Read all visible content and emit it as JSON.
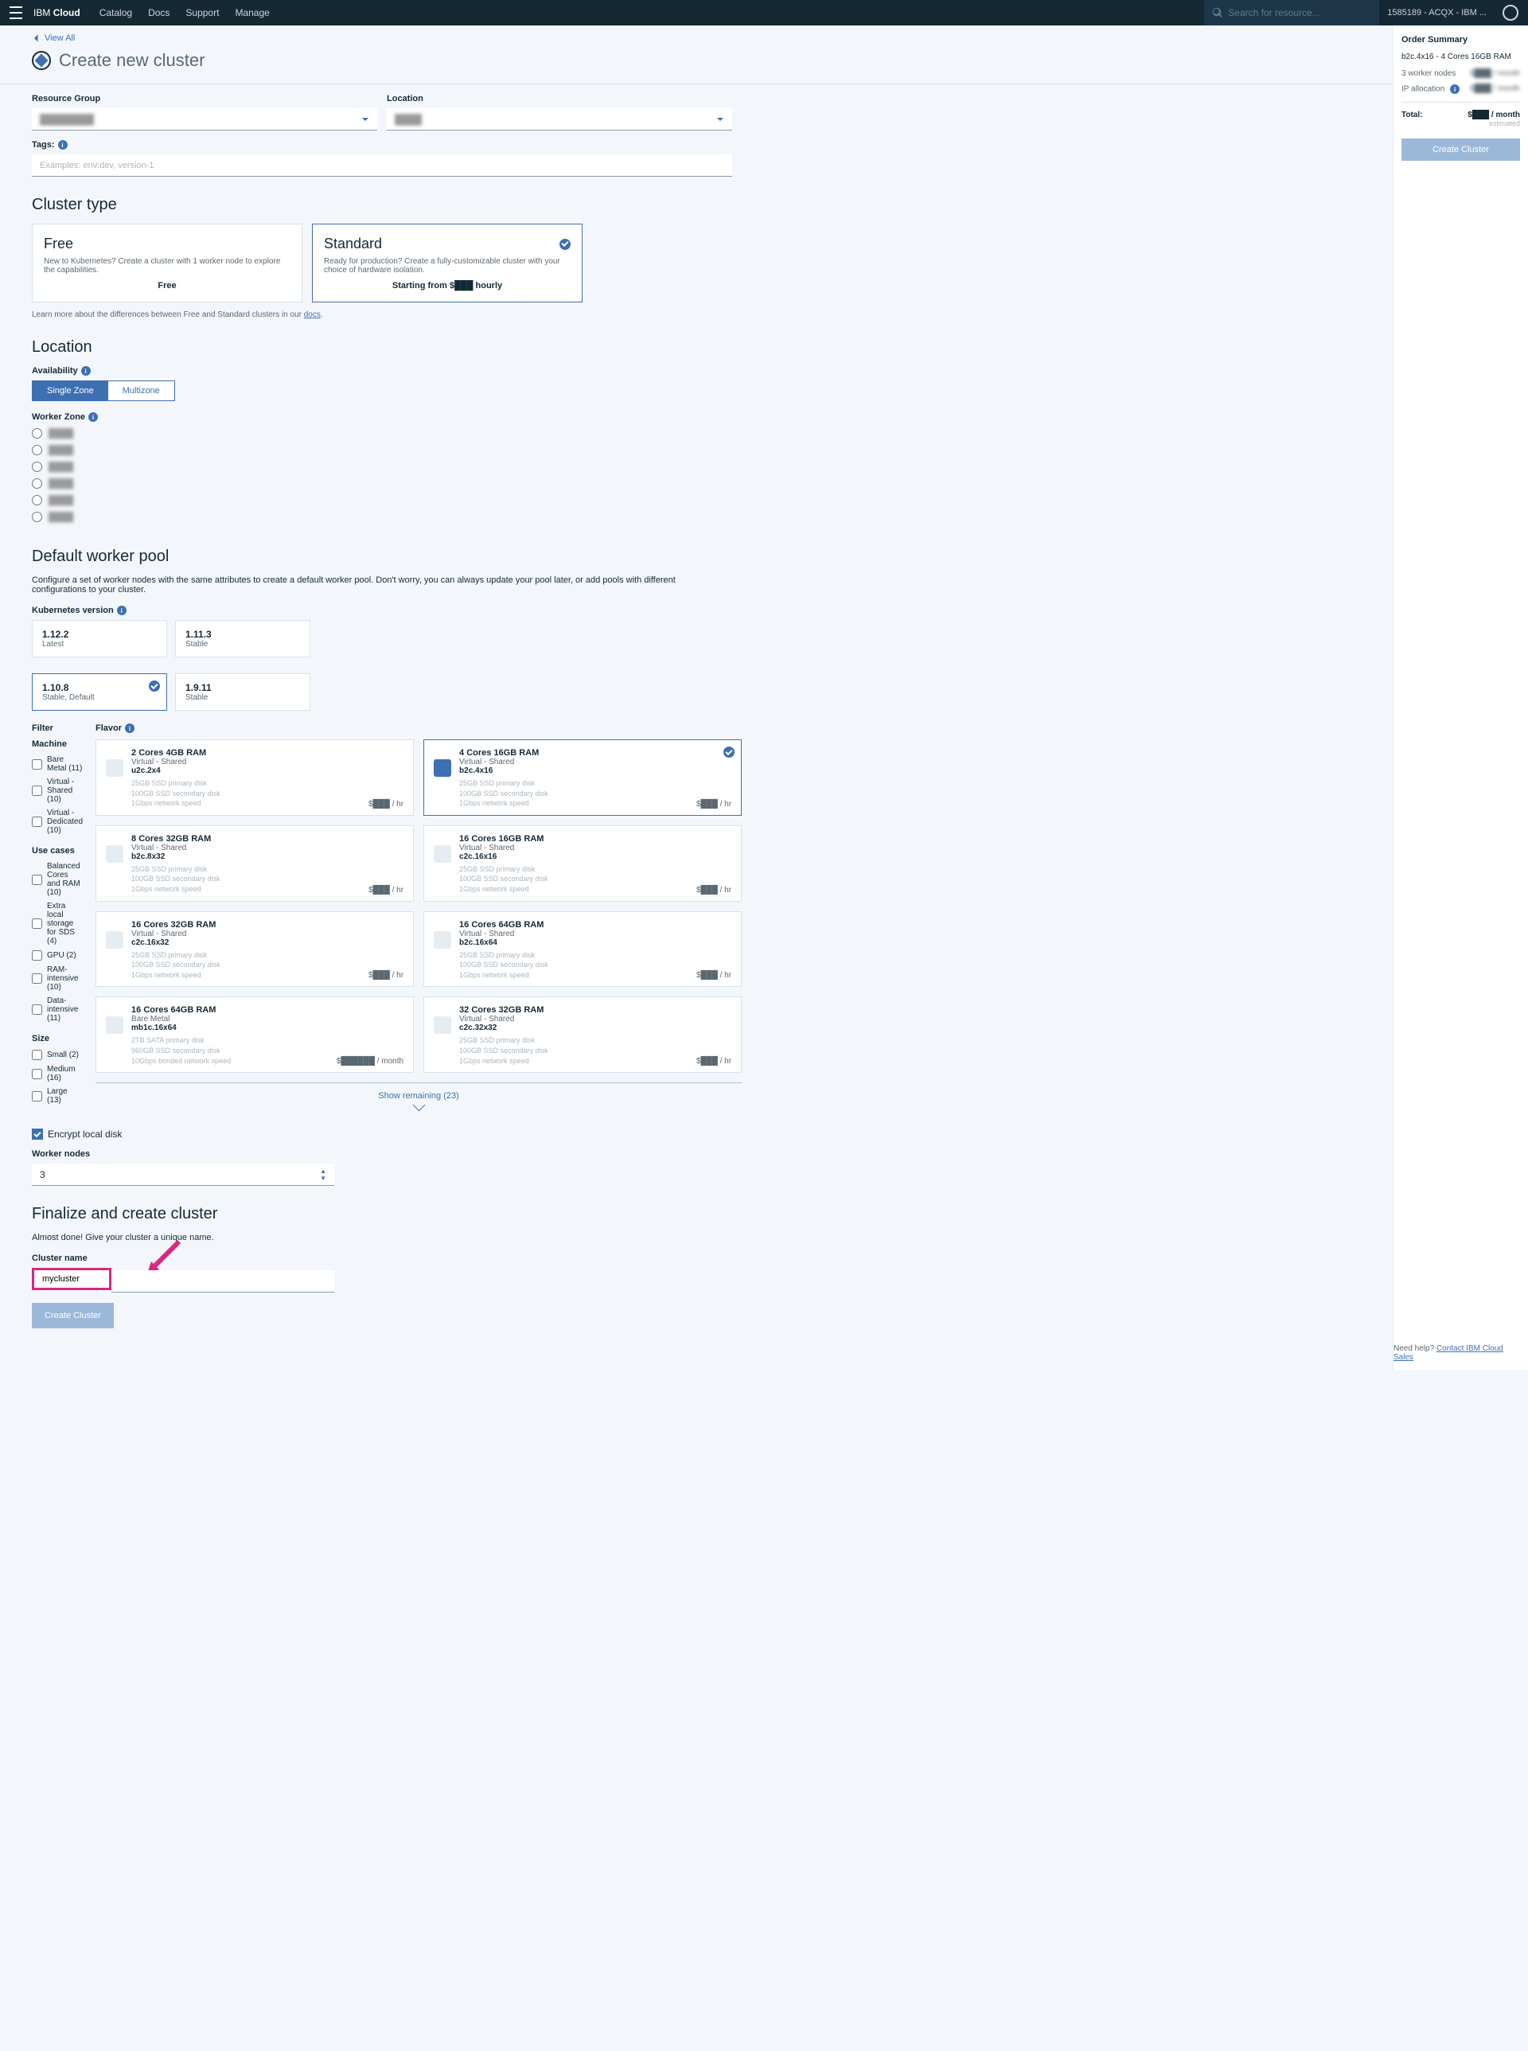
{
  "topbar": {
    "brand_prefix": "IBM",
    "brand_suffix": "Cloud",
    "nav": [
      "Catalog",
      "Docs",
      "Support",
      "Manage"
    ],
    "search_placeholder": "Search for resource...",
    "account": "1585189 - ACQX - IBM ..."
  },
  "header": {
    "back": "View All",
    "title": "Create new cluster"
  },
  "resource": {
    "group_label": "Resource Group",
    "group_value": "████████",
    "location_label": "Location",
    "location_value": "████",
    "tags_label": "Tags:",
    "tags_placeholder": "Examples: env:dev, version-1"
  },
  "cluster_type": {
    "heading": "Cluster type",
    "free": {
      "title": "Free",
      "desc": "New to Kubernetes? Create a cluster with 1 worker node to explore the capabilities.",
      "price": "Free"
    },
    "standard": {
      "title": "Standard",
      "desc": "Ready for production? Create a fully-customizable cluster with your choice of hardware isolation.",
      "price": "Starting from $███ hourly"
    },
    "note_prefix": "Learn more about the differences between Free and Standard clusters in our ",
    "note_link": "docs"
  },
  "location": {
    "heading": "Location",
    "availability_label": "Availability",
    "single": "Single Zone",
    "multi": "Multizone",
    "worker_zone_label": "Worker Zone",
    "zones": [
      "████",
      "████",
      "████",
      "████",
      "████",
      "████"
    ]
  },
  "pool": {
    "heading": "Default worker pool",
    "desc": "Configure a set of worker nodes with the same attributes to create a default worker pool. Don't worry, you can always update your pool later, or add pools with different configurations to your cluster.",
    "version_label": "Kubernetes version",
    "versions": [
      {
        "ver": "1.12.2",
        "sub": "Latest"
      },
      {
        "ver": "1.11.3",
        "sub": "Stable"
      },
      {
        "ver": "1.10.8",
        "sub": "Stable, Default",
        "selected": true
      },
      {
        "ver": "1.9.11",
        "sub": "Stable"
      }
    ],
    "filter_label": "Filter",
    "machine_label": "Machine",
    "machine_filters": [
      "Bare Metal (11)",
      "Virtual - Shared (10)",
      "Virtual - Dedicated (10)"
    ],
    "usecase_label": "Use cases",
    "usecase_filters": [
      "Balanced Cores and RAM (10)",
      "Extra local storage for SDS (4)",
      "GPU (2)",
      "RAM-intensive (10)",
      "Data-intensive (11)"
    ],
    "size_label": "Size",
    "size_filters": [
      "Small (2)",
      "Medium (16)",
      "Large (13)"
    ],
    "flavor_label": "Flavor",
    "flavors": [
      {
        "title": "2 Cores 4GB RAM",
        "type": "Virtual - Shared",
        "code": "u2c.2x4",
        "specs": [
          "25GB SSD primary disk",
          "100GB SSD secondary disk",
          "1Gbps network speed"
        ],
        "price": "$███ / hr"
      },
      {
        "title": "4 Cores 16GB RAM",
        "type": "Virtual - Shared",
        "code": "b2c.4x16",
        "specs": [
          "25GB SSD primary disk",
          "100GB SSD secondary disk",
          "1Gbps network speed"
        ],
        "price": "$███ / hr",
        "selected": true
      },
      {
        "title": "8 Cores 32GB RAM",
        "type": "Virtual - Shared",
        "code": "b2c.8x32",
        "specs": [
          "25GB SSD primary disk",
          "100GB SSD secondary disk",
          "1Gbps network speed"
        ],
        "price": "$███ / hr"
      },
      {
        "title": "16 Cores 16GB RAM",
        "type": "Virtual - Shared",
        "code": "c2c.16x16",
        "specs": [
          "25GB SSD primary disk",
          "100GB SSD secondary disk",
          "1Gbps network speed"
        ],
        "price": "$███ / hr"
      },
      {
        "title": "16 Cores 32GB RAM",
        "type": "Virtual - Shared",
        "code": "c2c.16x32",
        "specs": [
          "25GB SSD primary disk",
          "100GB SSD secondary disk",
          "1Gbps network speed"
        ],
        "price": "$███ / hr"
      },
      {
        "title": "16 Cores 64GB RAM",
        "type": "Virtual - Shared",
        "code": "b2c.16x64",
        "specs": [
          "25GB SSD primary disk",
          "100GB SSD secondary disk",
          "1Gbps network speed"
        ],
        "price": "$███ / hr"
      },
      {
        "title": "16 Cores 64GB RAM",
        "type": "Bare Metal",
        "code": "mb1c.16x64",
        "specs": [
          "2TB SATA primary disk",
          "960GB SSD secondary disk",
          "10Gbps bonded network speed"
        ],
        "price": "$██████ / month"
      },
      {
        "title": "32 Cores 32GB RAM",
        "type": "Virtual - Shared",
        "code": "c2c.32x32",
        "specs": [
          "25GB SSD primary disk",
          "100GB SSD secondary disk",
          "1Gbps network speed"
        ],
        "price": "$███ / hr"
      }
    ],
    "show_more": "Show remaining (23)",
    "encrypt_label": "Encrypt local disk",
    "workers_label": "Worker nodes",
    "workers_value": "3"
  },
  "finalize": {
    "heading": "Finalize and create cluster",
    "desc": "Almost done! Give your cluster a unique name.",
    "name_label": "Cluster name",
    "name_value": "mycluster",
    "create_btn": "Create Cluster"
  },
  "summary": {
    "heading": "Order Summary",
    "item_title": "b2c.4x16 - 4 Cores 16GB RAM",
    "workers": "3 worker nodes",
    "workers_price": "$███ / month",
    "ip": "IP allocation",
    "ip_price": "$███ / month",
    "total_label": "Total:",
    "total_price": "$███ / month",
    "estimated": "estimated",
    "create_btn": "Create Cluster",
    "help_prefix": "Need help? ",
    "help_link": "Contact IBM Cloud Sales"
  }
}
